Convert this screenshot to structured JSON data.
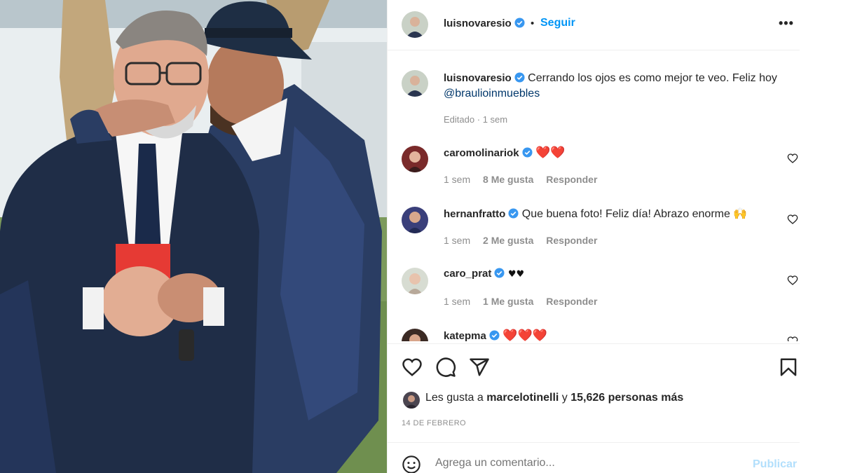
{
  "post": {
    "author": "luisnovaresio",
    "follow_label": "Seguir",
    "separator": "•",
    "more_label": "•••",
    "caption": "Cerrando los ojos es como mejor te veo. Feliz hoy",
    "caption_mention": "@braulioinmuebles",
    "edited_label": "Editado",
    "edited_sep": "·",
    "edited_time": "1 sem"
  },
  "comments": [
    {
      "username": "caromolinariok",
      "text": "❤️❤️",
      "time": "1 sem",
      "likes": "8 Me gusta",
      "reply": "Responder"
    },
    {
      "username": "hernanfratto",
      "text": "Que buena foto! Feliz día! Abrazo enorme",
      "emoji": "🙌",
      "time": "1 sem",
      "likes": "2 Me gusta",
      "reply": "Responder"
    },
    {
      "username": "caro_prat",
      "text": "♥♥",
      "time": "1 sem",
      "likes": "1 Me gusta",
      "reply": "Responder"
    },
    {
      "username": "katepma",
      "text": "❤️❤️❤️"
    }
  ],
  "likes": {
    "prefix": "Les gusta a",
    "user": "marcelotinelli",
    "connector": "y",
    "count": "15,626 personas más"
  },
  "date": "14 DE FEBRERO",
  "comment_box": {
    "placeholder": "Agrega un comentario...",
    "publish_label": "Publicar"
  },
  "icons": {
    "like": "heart-icon",
    "comment": "comment-icon",
    "share": "share-icon",
    "save": "bookmark-icon",
    "emoji": "emoji-icon",
    "verified": "verified-badge-icon",
    "more": "more-options-icon"
  },
  "colors": {
    "link": "#0095f6",
    "verified": "#3897f0",
    "muted": "#8e8e8e",
    "mention": "#00376b",
    "publish_disabled": "#b2dffc"
  }
}
